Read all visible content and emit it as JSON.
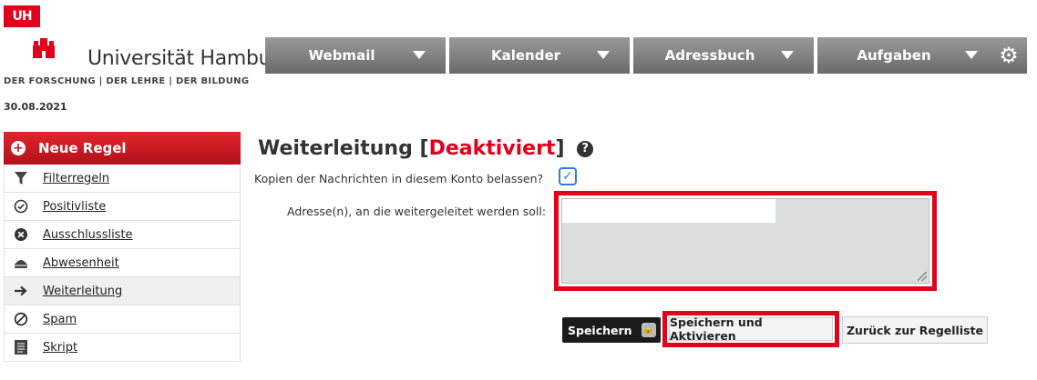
{
  "brand": {
    "logo_text": "UH",
    "name": "Universität Hamburg",
    "tagline": "DER FORSCHUNG | DER LEHRE | DER BILDUNG"
  },
  "date": "30.08.2021",
  "nav": [
    {
      "label": "Webmail"
    },
    {
      "label": "Kalender"
    },
    {
      "label": "Adressbuch"
    },
    {
      "label": "Aufgaben"
    }
  ],
  "sidebar": {
    "new_rule": "Neue Regel",
    "items": [
      {
        "label": "Filterregeln",
        "icon": "filter-icon"
      },
      {
        "label": "Positivliste",
        "icon": "check-circle-icon"
      },
      {
        "label": "Ausschlussliste",
        "icon": "x-circle-icon"
      },
      {
        "label": "Abwesenheit",
        "icon": "cake-icon"
      },
      {
        "label": "Weiterleitung",
        "icon": "arrow-right-icon"
      },
      {
        "label": "Spam",
        "icon": "forbidden-icon"
      },
      {
        "label": "Skript",
        "icon": "document-icon"
      }
    ]
  },
  "main": {
    "title": "Weiterleitung",
    "status": "Deaktiviert",
    "keep_copy_label": "Kopien der Nachrichten in diesem Konto belassen?",
    "keep_copy_checked": true,
    "address_label": "Adresse(n), an die weitergeleitet werden soll:",
    "address_value": ""
  },
  "buttons": {
    "save": "Speichern",
    "save_activate": "Speichern und Aktivieren",
    "back": "Zurück zur Regelliste"
  },
  "colors": {
    "accent_red": "#e2001a",
    "nav_gray": "#808080",
    "checkbox_blue": "#2f7de1"
  }
}
